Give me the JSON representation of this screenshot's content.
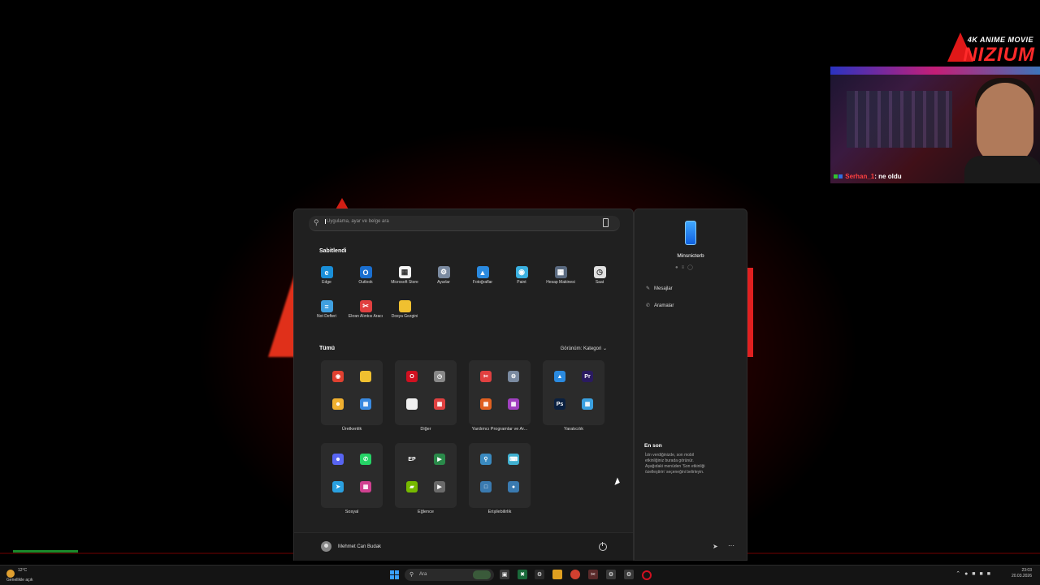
{
  "overlay": {
    "logo_top": "4K ANIME MOVIE",
    "logo_main": "NIZIUM",
    "chat_user": "Serhan_1",
    "chat_message": ": ne oldu"
  },
  "start_menu": {
    "search_placeholder": "Uygulama, ayar ve belge ara",
    "pinned_title": "Sabitlendi",
    "pinned": [
      {
        "label": "Edge",
        "icon": "edge-icon",
        "color": "#1a8fd8"
      },
      {
        "label": "Outlook",
        "icon": "outlook-icon",
        "color": "#1a6fd0"
      },
      {
        "label": "Microsoft Store",
        "icon": "store-icon",
        "color": "#f3f3f3"
      },
      {
        "label": "Ayarlar",
        "icon": "gear-icon",
        "color": "#7a8aa0"
      },
      {
        "label": "Fotoğraflar",
        "icon": "photos-icon",
        "color": "#2a8ae0"
      },
      {
        "label": "Paint",
        "icon": "paint-icon",
        "color": "#3ab0e0"
      },
      {
        "label": "Hesap Makinesi",
        "icon": "calculator-icon",
        "color": "#5a6a80"
      },
      {
        "label": "Saat",
        "icon": "clock-icon",
        "color": "#e0e0e0"
      },
      {
        "label": "Not Defteri",
        "icon": "notepad-icon",
        "color": "#40a0e0"
      },
      {
        "label": "Ekran Alıntısı Aracı",
        "icon": "snipping-icon",
        "color": "#e04040"
      },
      {
        "label": "Dosya Gezgini",
        "icon": "folder-icon",
        "color": "#f0c030"
      }
    ],
    "all_title": "Tümü",
    "view_label": "Görünüm: Kategori",
    "categories": [
      {
        "label": "Üretkenlik",
        "icons": [
          "chrome-icon",
          "folder-icon",
          "discord-bot-icon",
          "apps-icon"
        ],
        "colors": [
          "#e04030",
          "#f0c030",
          "#f0b030",
          "#3a8ae0"
        ]
      },
      {
        "label": "Diğer",
        "icons": [
          "opera-icon",
          "clock-icon",
          "file-icon",
          "apps-icon"
        ],
        "colors": [
          "#d01020",
          "#888888",
          "#f0f0f0",
          "#e04040"
        ]
      },
      {
        "label": "Yardımcı Programlar ve Ar...",
        "icons": [
          "snipping-icon",
          "gear-icon",
          "apps-icon",
          "apps-icon"
        ],
        "colors": [
          "#e04040",
          "#7a8aa0",
          "#e06020",
          "#a040c0"
        ]
      },
      {
        "label": "Yaratıcılık",
        "icons": [
          "photos-icon",
          "premiere-icon",
          "photoshop-icon",
          "apps-icon"
        ],
        "colors": [
          "#2a8ae0",
          "#2a1a60",
          "#0a2040",
          "#3aa0e0"
        ]
      },
      {
        "label": "Sosyal",
        "icons": [
          "discord-icon",
          "whatsapp-icon",
          "telegram-icon",
          "apps-icon"
        ],
        "colors": [
          "#5865f2",
          "#25d366",
          "#2aa0e0",
          "#d04090"
        ]
      },
      {
        "label": "Eğlence",
        "icons": [
          "epic-icon",
          "games-icon",
          "nvidia-icon",
          "play-icon"
        ],
        "colors": [
          "#2a2a2a",
          "#2a8a4a",
          "#76b900",
          "#6a6a6a"
        ]
      },
      {
        "label": "Erişilebilirlik",
        "icons": [
          "magnifier-icon",
          "keyboard-icon",
          "narrator-icon",
          "voice-icon"
        ],
        "colors": [
          "#3a8ac0",
          "#40b0d0",
          "#3a7ab0",
          "#3a7ab0"
        ]
      }
    ],
    "user_name": "Mehmet Can Budak"
  },
  "phone_panel": {
    "device_name": "Minsnicterb",
    "items": [
      {
        "label": "Mesajlar",
        "icon": "message-icon"
      },
      {
        "label": "Aramalar",
        "icon": "phone-call-icon"
      }
    ],
    "recent_title": "En son",
    "recent_desc": "İzin verdiğinizde, son mobil etkinliğiniz burada görünür. Aşağıdaki menüden 'Son etkinliği özelleştirin' seçeneğini belirleyin."
  },
  "taskbar": {
    "weather_temp": "12°C",
    "weather_desc": "Genellikle açık",
    "search_label": "Ara",
    "time": "23:03",
    "date": "20.03.2026"
  }
}
